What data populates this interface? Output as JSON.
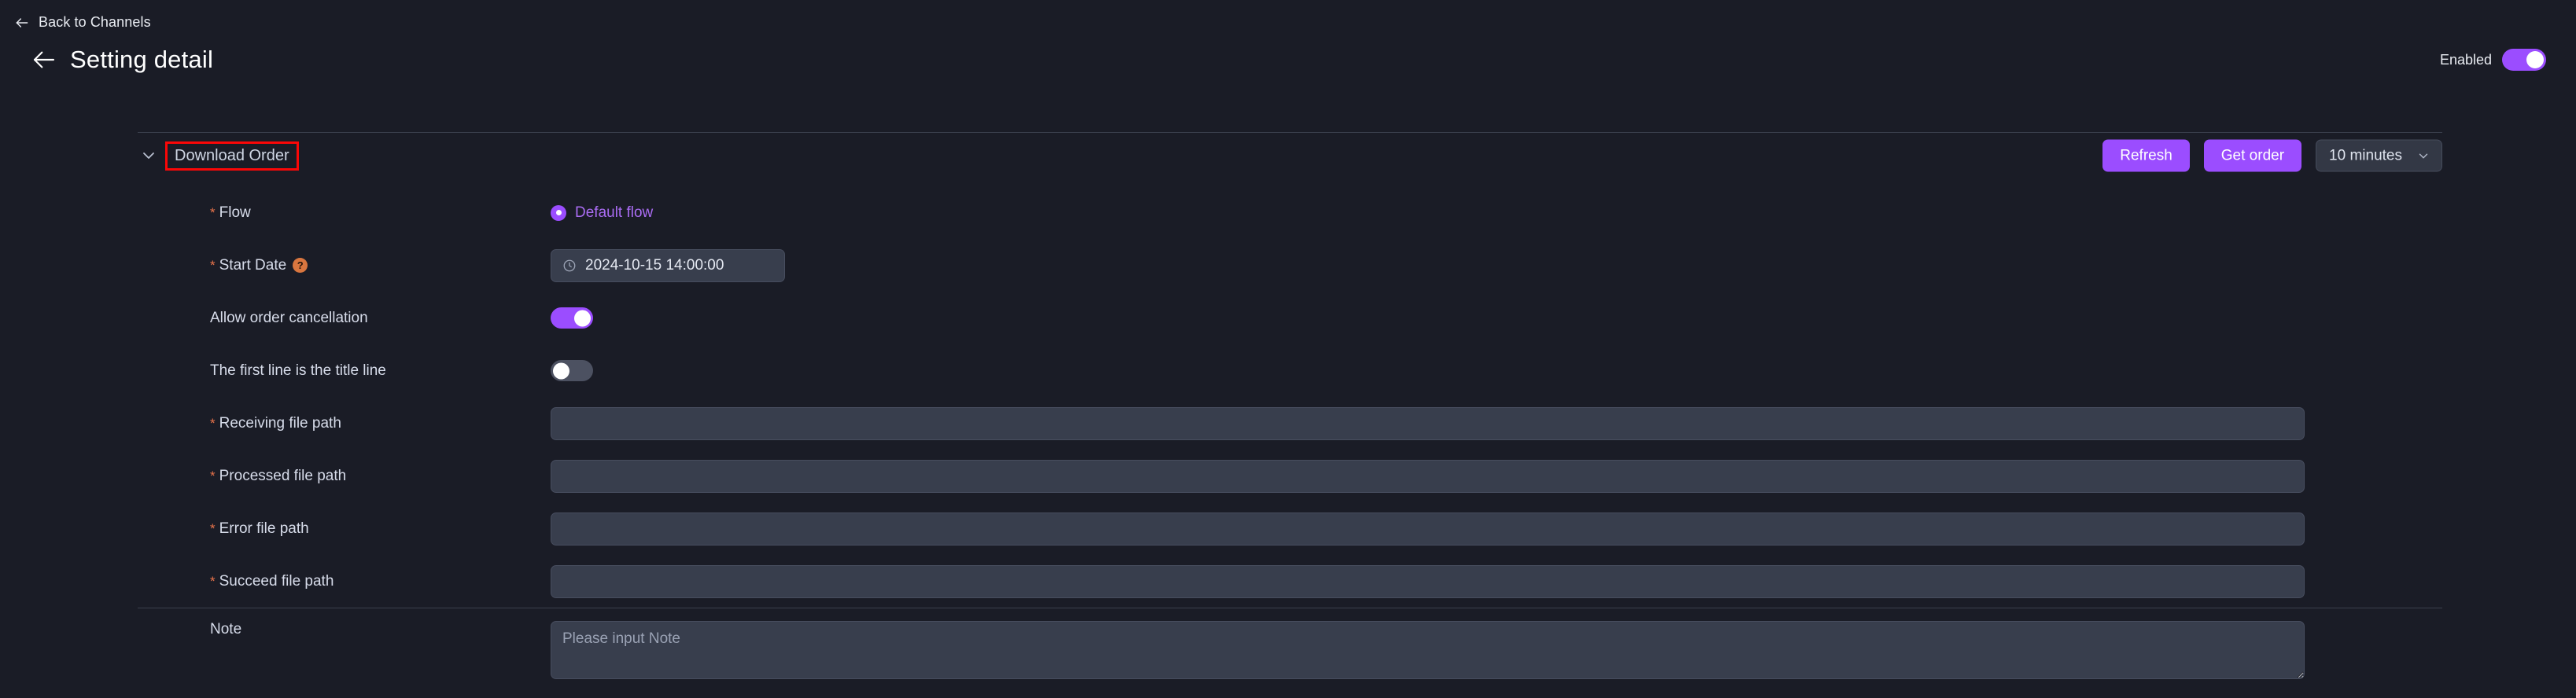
{
  "topbar": {
    "back_link_label": "Back to Channels",
    "back_icon": "arrow-left-icon",
    "page_title": "Setting detail",
    "title_back_icon": "arrow-left-icon",
    "enabled_label": "Enabled",
    "enabled_state": "on"
  },
  "section": {
    "collapse_icon": "chevron-down-icon",
    "title": "Download Order",
    "title_highlight_color": "#fb0707",
    "actions": {
      "refresh_label": "Refresh",
      "get_order_label": "Get order",
      "interval_value": "10 minutes",
      "interval_chevron_icon": "chevron-down-icon"
    }
  },
  "form": {
    "flow": {
      "label": "Flow",
      "required": "*",
      "option_label": "Default flow",
      "selected": true
    },
    "start_date": {
      "label": "Start Date",
      "required": "*",
      "help_icon": "question-mark-icon",
      "help_glyph": "?",
      "clock_icon": "clock-icon",
      "value": "2024-10-15 14:00:00"
    },
    "allow_cancel": {
      "label": "Allow order cancellation",
      "state": "on"
    },
    "first_line_title": {
      "label": "The first line is the title line",
      "state": "off"
    },
    "receiving_path": {
      "label": "Receiving file path",
      "required": "*",
      "value": "",
      "placeholder": ""
    },
    "processed_path": {
      "label": "Processed file path",
      "required": "*",
      "value": "",
      "placeholder": ""
    },
    "error_path": {
      "label": "Error file path",
      "required": "*",
      "value": "",
      "placeholder": ""
    },
    "succeed_path": {
      "label": "Succeed file path",
      "required": "*",
      "value": "",
      "placeholder": ""
    },
    "note": {
      "label": "Note",
      "value": "",
      "placeholder": "Please input Note"
    }
  },
  "colors": {
    "page_bg": "#1a1c26",
    "accent_purple": "#9b4dff",
    "input_bg": "#383e4d",
    "divider": "#3a3f4d",
    "required_star": "#e8734a",
    "highlight_outline": "#fb0707"
  }
}
